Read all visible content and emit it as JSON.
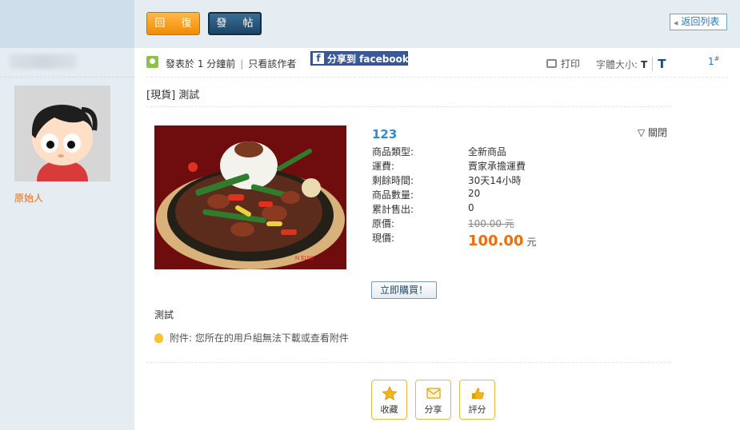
{
  "header": {
    "reply_label": "回 復",
    "post_label": "發 帖",
    "back_label": "返回列表"
  },
  "author": {
    "role": "原始人"
  },
  "meta": {
    "posted": "發表於 1 分鐘前",
    "author_only": "只看該作者",
    "share_fb": "分享到 facebook",
    "print_label": "打印",
    "font_size_label": "字體大小:",
    "font_small": "T",
    "font_big": "T",
    "floor": "1",
    "floor_mark": "#"
  },
  "post": {
    "title": "[現貨] 測試",
    "body": "測試",
    "attachment_note": "附件: 您所在的用戶組無法下載或查看附件"
  },
  "product": {
    "name": "123",
    "close_label": "▽ 關閉",
    "specs": [
      {
        "label": "商品類型:",
        "value": "全新商品"
      },
      {
        "label": "運費:",
        "value": "賣家承擔運費"
      },
      {
        "label": "剩餘時間:",
        "value": "30天14小時"
      },
      {
        "label": "商品數量:",
        "value": "20"
      },
      {
        "label": "累計售出:",
        "value": "0"
      },
      {
        "label": "原價:",
        "value": "100.00 元"
      }
    ],
    "current_price_label": "現價:",
    "current_price": "100.00",
    "currency": "元",
    "buy_label": "立即購買！"
  },
  "actions": {
    "favorite": "收藏",
    "share": "分享",
    "rate": "評分"
  },
  "colors": {
    "accent_orange": "#f08c00",
    "price_orange": "#f26c05",
    "link_blue": "#2b78b4"
  }
}
